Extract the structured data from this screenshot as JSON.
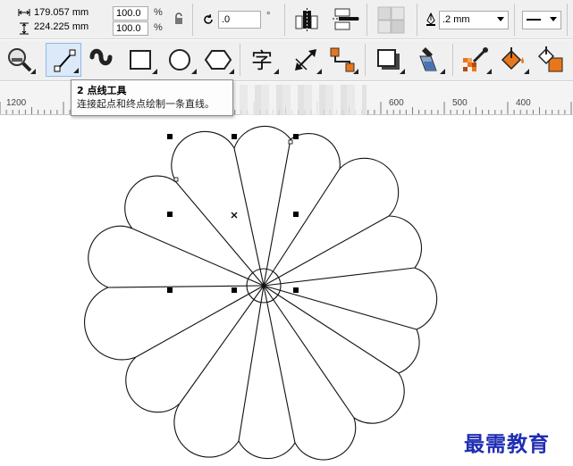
{
  "property_bar": {
    "width_value": "179.057 mm",
    "height_value": "224.225 mm",
    "scale_x": "100.0",
    "scale_y": "100.0",
    "percent_symbol_1": "%",
    "percent_symbol_2": "%",
    "rotation_value": ".0",
    "degree_symbol": "°",
    "outline_width": ".2 mm"
  },
  "toolbox": {
    "tools": [
      {
        "name": "zoom-tool",
        "icon": "magnifier-icon"
      },
      {
        "name": "two-point-line-tool",
        "icon": "two-point-line-icon",
        "active": true
      },
      {
        "name": "artistic-media-tool",
        "icon": "artistic-media-icon"
      },
      {
        "name": "rectangle-tool",
        "icon": "rectangle-icon"
      },
      {
        "name": "ellipse-tool",
        "icon": "ellipse-icon"
      },
      {
        "name": "polygon-tool",
        "icon": "polygon-icon"
      },
      {
        "name": "text-tool",
        "icon": "text-icon",
        "glyph": "字"
      },
      {
        "name": "parallel-dimension-tool",
        "icon": "dimension-icon"
      },
      {
        "name": "connector-tool",
        "icon": "connector-icon"
      },
      {
        "name": "drop-shadow-tool",
        "icon": "drop-shadow-icon"
      },
      {
        "name": "eyedropper-tool",
        "icon": "eyedropper-icon"
      },
      {
        "name": "color-eyedropper-tool",
        "icon": "color-eyedropper-icon"
      },
      {
        "name": "interactive-fill-tool",
        "icon": "fill-bucket-icon"
      },
      {
        "name": "smart-fill-tool",
        "icon": "smart-fill-icon"
      }
    ]
  },
  "ruler": {
    "labels": [
      "1200",
      "600",
      "500",
      "400"
    ]
  },
  "tooltip": {
    "title": "2 点线工具",
    "description": "连接起点和终点绘制一条直线。"
  },
  "watermark": "最需教育",
  "colors": {
    "toolbar_bg": "#f0f0f0",
    "active_tool_bg": "#dbe9f9",
    "active_tool_border": "#91b8e8",
    "accent_orange": "#e8761a",
    "watermark_blue": "#1f2db3"
  }
}
